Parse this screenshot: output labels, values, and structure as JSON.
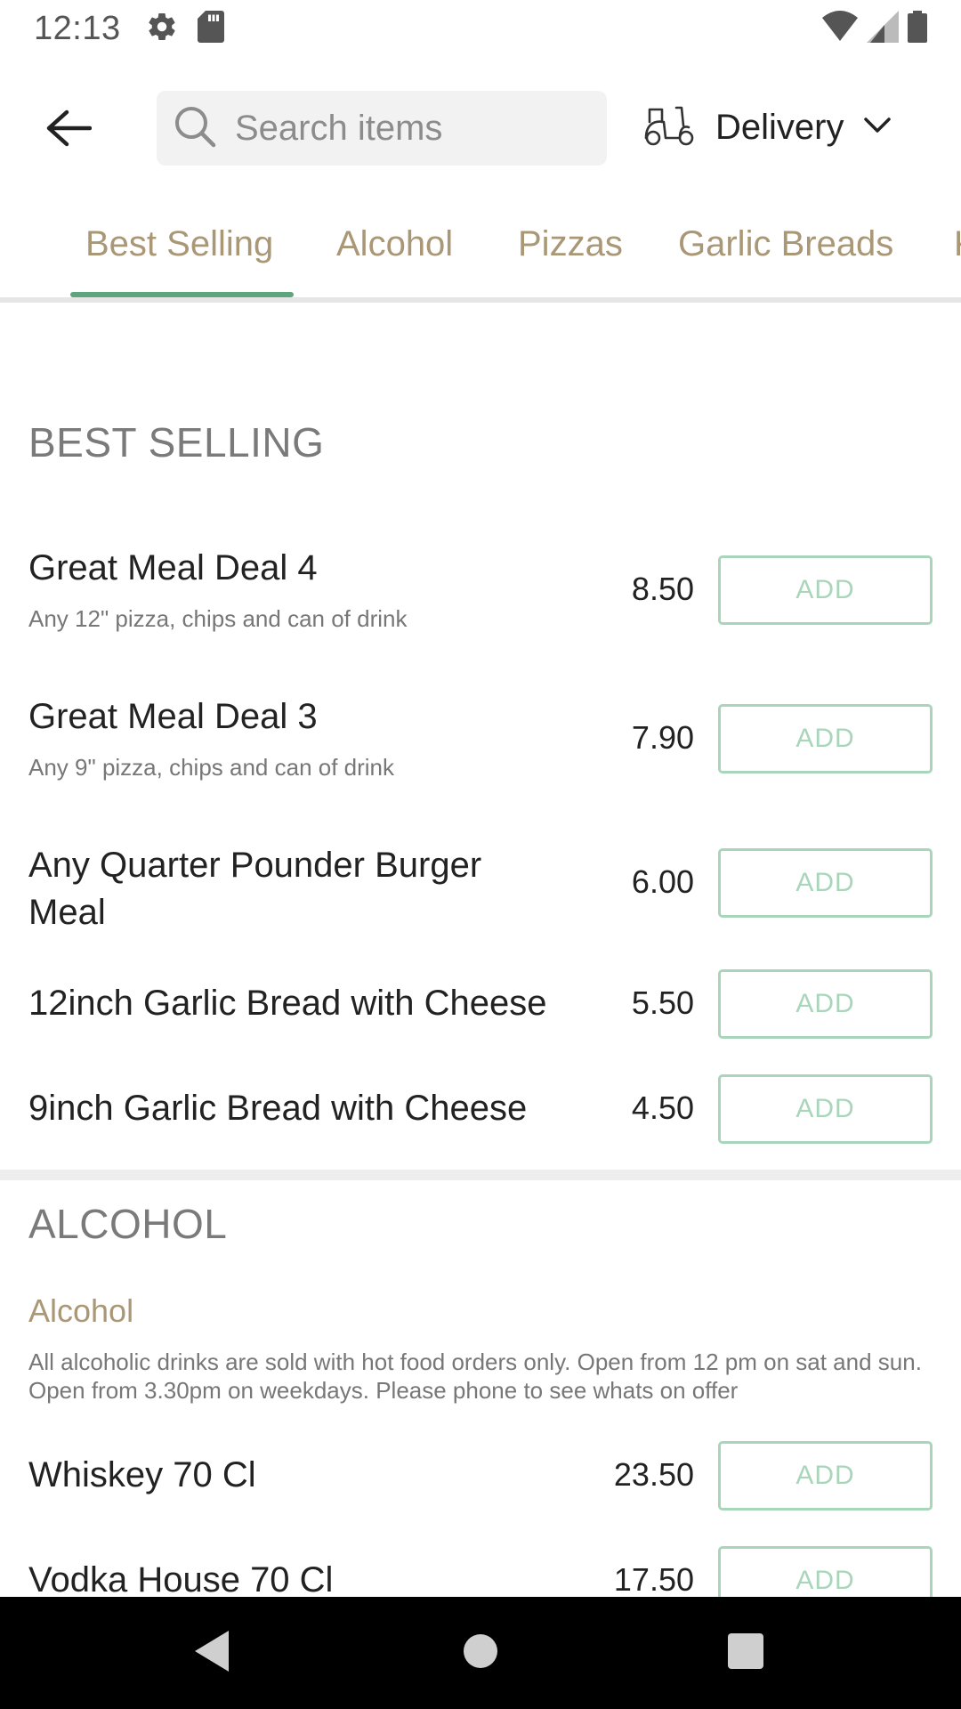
{
  "status_bar": {
    "time": "12:13"
  },
  "appbar": {
    "search_placeholder": "Search items",
    "delivery_label": "Delivery"
  },
  "tabs": [
    {
      "label": "Best Selling"
    },
    {
      "label": "Alcohol"
    },
    {
      "label": "Pizzas"
    },
    {
      "label": "Garlic Breads"
    },
    {
      "label": "K"
    }
  ],
  "sections": {
    "best_selling": {
      "title": "BEST SELLING",
      "items": [
        {
          "name": "Great Meal Deal 4",
          "description": "Any 12\" pizza, chips and can of drink",
          "price": "8.50",
          "add_label": "ADD"
        },
        {
          "name": "Great Meal Deal 3",
          "description": "Any 9\" pizza, chips and can of drink",
          "price": "7.90",
          "add_label": "ADD"
        },
        {
          "name": "Any Quarter Pounder Burger Meal",
          "price": "6.00",
          "add_label": "ADD"
        },
        {
          "name": "12inch Garlic Bread with Cheese",
          "price": "5.50",
          "add_label": "ADD"
        },
        {
          "name": "9inch Garlic Bread with Cheese",
          "price": "4.50",
          "add_label": "ADD"
        }
      ]
    },
    "alcohol": {
      "title": "ALCOHOL",
      "subcategory": "Alcohol",
      "subcategory_description": "All alcoholic drinks are sold with hot food orders only. Open from 12 pm on sat and sun. Open from 3.30pm on weekdays. Please phone to see whats on offer",
      "items": [
        {
          "name": "Whiskey 70 Cl",
          "price": "23.50",
          "add_label": "ADD"
        },
        {
          "name": "Vodka House 70 Cl",
          "price": "17.50",
          "add_label": "ADD"
        }
      ]
    }
  },
  "colors": {
    "accent_green": "#5ea47c",
    "tab_text": "#a99776",
    "add_button": "#a9d6bb"
  }
}
